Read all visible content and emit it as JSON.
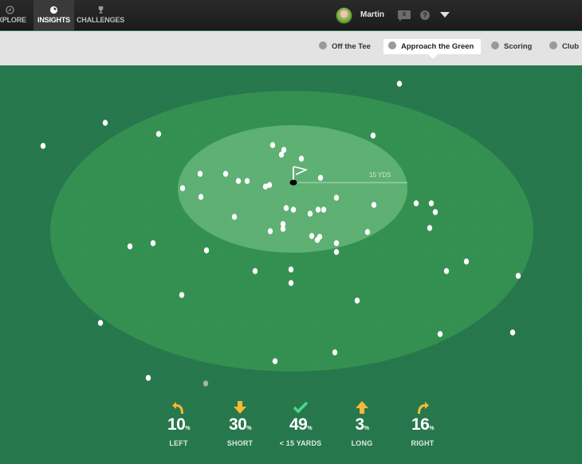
{
  "nav": {
    "items": [
      {
        "label": "EXPLORE",
        "icon": "compass-icon",
        "active": false
      },
      {
        "label": "INSIGHTS",
        "icon": "pie-icon",
        "active": true
      },
      {
        "label": "CHALLENGES",
        "icon": "trophy-icon",
        "active": false
      }
    ],
    "user_name": "Martin",
    "message_count": "0",
    "help_label": "?"
  },
  "tabs": [
    {
      "label": "Off the Tee",
      "icon": "tee-icon",
      "active": false
    },
    {
      "label": "Approach the Green",
      "icon": "flag-icon",
      "active": true
    },
    {
      "label": "Scoring",
      "icon": "scoring-icon",
      "active": false
    },
    {
      "label": "Club",
      "icon": "club-icon",
      "active": false
    }
  ],
  "green": {
    "distance_label": "15 YDS",
    "colors": {
      "rough": "#26764c",
      "green": "#3a9a52",
      "inner": "#62b274"
    }
  },
  "stats": [
    {
      "value": "10",
      "unit": "%",
      "label": "LEFT",
      "icon": "turn-left-arrow-icon",
      "color": "#f5b937"
    },
    {
      "value": "30",
      "unit": "%",
      "label": "SHORT",
      "icon": "down-arrow-icon",
      "color": "#f5b937"
    },
    {
      "value": "49",
      "unit": "%",
      "label": "< 15 YARDS",
      "icon": "check-icon",
      "color": "#4cd98a"
    },
    {
      "value": "3",
      "unit": "%",
      "label": "LONG",
      "icon": "up-arrow-icon",
      "color": "#f5b937"
    },
    {
      "value": "16",
      "unit": "%",
      "label": "RIGHT",
      "icon": "turn-right-arrow-icon",
      "color": "#f5b937"
    }
  ]
}
